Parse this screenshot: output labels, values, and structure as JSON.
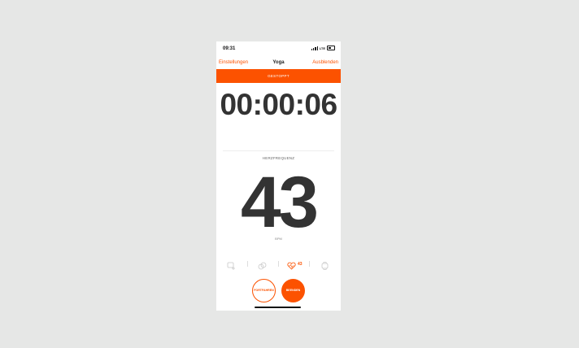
{
  "status_bar": {
    "time": "09:31",
    "network": "LTE"
  },
  "nav": {
    "back_label": "Einstellungen",
    "title": "Yoga",
    "hide_label": "Ausblenden"
  },
  "banner": {
    "text": "GESTOPPT"
  },
  "timer": {
    "value": "00:00:06"
  },
  "metric": {
    "label": "HERZFREQUENZ",
    "value": "43",
    "unit": "BPM"
  },
  "sensors": {
    "items": [
      {
        "icon": "phone-sensor-icon",
        "active": false
      },
      {
        "icon": "cadence-sensor-icon",
        "active": false
      },
      {
        "icon": "heart-rate-icon",
        "active": true,
        "value": "43"
      },
      {
        "icon": "watch-icon",
        "active": false
      }
    ]
  },
  "buttons": {
    "resume_label": "FORTFAHREN",
    "finish_label": "BEENDEN"
  },
  "colors": {
    "accent": "#fc5200",
    "text": "#333333",
    "background": "#e6e7e6"
  }
}
